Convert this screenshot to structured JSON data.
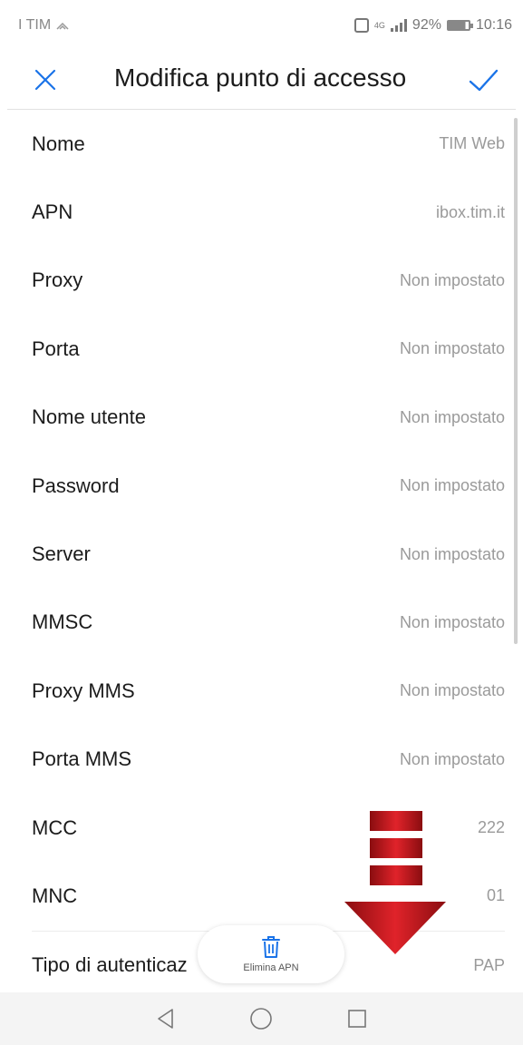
{
  "status_bar": {
    "carrier": "I TIM",
    "network": "4G",
    "battery_percent": "92%",
    "time": "10:16"
  },
  "header": {
    "title": "Modifica punto di accesso",
    "close_icon": "close-icon",
    "confirm_icon": "check-icon"
  },
  "fields": [
    {
      "label": "Nome",
      "value": "TIM Web"
    },
    {
      "label": "APN",
      "value": "ibox.tim.it"
    },
    {
      "label": "Proxy",
      "value": "Non impostato"
    },
    {
      "label": "Porta",
      "value": "Non impostato"
    },
    {
      "label": "Nome utente",
      "value": "Non impostato"
    },
    {
      "label": "Password",
      "value": "Non impostato"
    },
    {
      "label": "Server",
      "value": "Non impostato"
    },
    {
      "label": "MMSC",
      "value": "Non impostato"
    },
    {
      "label": "Proxy MMS",
      "value": "Non impostato"
    },
    {
      "label": "Porta MMS",
      "value": "Non impostato"
    },
    {
      "label": "MCC",
      "value": "222"
    },
    {
      "label": "MNC",
      "value": "01"
    },
    {
      "label": "Tipo di autenticaz",
      "value": "PAP"
    }
  ],
  "delete_action": {
    "label": "Elimina APN",
    "icon": "trash-icon"
  },
  "nav": {
    "back_icon": "back-triangle-icon",
    "home_icon": "home-circle-icon",
    "recents_icon": "recents-square-icon"
  },
  "colors": {
    "accent": "#1a73e8",
    "arrow_red": "#c4161c"
  }
}
